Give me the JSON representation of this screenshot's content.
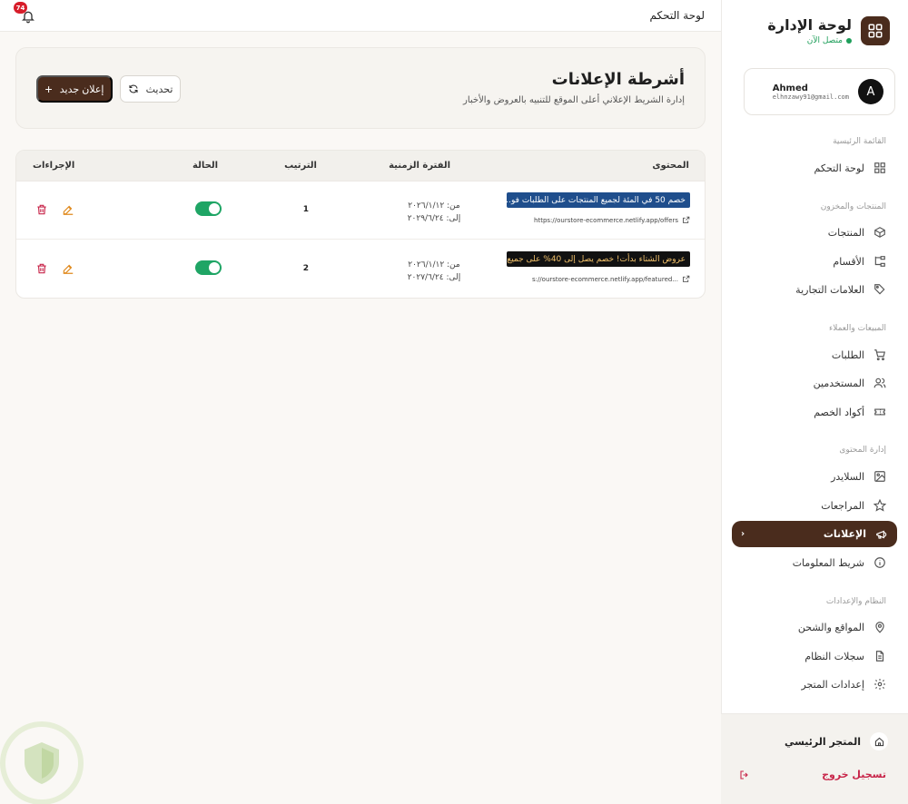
{
  "brand": {
    "title": "لوحة الإدارة",
    "status": "متصل الآن"
  },
  "user": {
    "initial": "A",
    "name": "Ahmed",
    "email": "elhnzawy91@gmail.com"
  },
  "nav": {
    "sections": [
      "القائمة الرئيسية",
      "المنتجات والمخزون",
      "المبيعات والعملاء",
      "إدارة المحتوى",
      "النظام والإعدادات"
    ],
    "items": [
      {
        "label": "لوحة التحكم",
        "icon": "grid-icon"
      },
      {
        "label": "المنتجات",
        "icon": "box-icon"
      },
      {
        "label": "الأقسام",
        "icon": "categories-icon"
      },
      {
        "label": "العلامات التجارية",
        "icon": "tag-icon"
      },
      {
        "label": "الطلبات",
        "icon": "cart-icon"
      },
      {
        "label": "المستخدمين",
        "icon": "users-icon"
      },
      {
        "label": "أكواد الخصم",
        "icon": "ticket-icon"
      },
      {
        "label": "السلايدر",
        "icon": "image-icon"
      },
      {
        "label": "المراجعات",
        "icon": "star-icon"
      },
      {
        "label": "الإعلانات",
        "icon": "megaphone-icon"
      },
      {
        "label": "شريط المعلومات",
        "icon": "info-icon"
      },
      {
        "label": "المواقع والشحن",
        "icon": "map-pin-icon"
      },
      {
        "label": "سجلات النظام",
        "icon": "file-icon"
      },
      {
        "label": "إعدادات المتجر",
        "icon": "gear-icon"
      }
    ],
    "active_index": 9
  },
  "footer": {
    "home": "المتجر الرئيسي",
    "logout": "تسجيل خروج"
  },
  "topbar": {
    "title": "لوحة التحكم",
    "notifications": "74"
  },
  "page": {
    "title": "أشرطة الإعلانات",
    "subtitle": "إدارة الشريط الإعلاني أعلى الموقع للتنبيه بالعروض والأخبار",
    "refresh_label": "تحديث",
    "new_label": "إعلان جديد"
  },
  "table": {
    "headers": {
      "content": "المحتوى",
      "period": "الفترة الزمنية",
      "order": "الترتيب",
      "status": "الحالة",
      "actions": "الإجراءات"
    },
    "rows": [
      {
        "text": "خصم 50 في المئة لجميع المنتجات على الطلبات فو...",
        "bg": "#1f4e8c",
        "fg": "#ffffff",
        "link": "https://ourstore-ecommerce.netlify.app/offers",
        "from": "من: ٢٠٢٦/١/١٢",
        "to": "إلى: ٢٠٢٩/٦/٢٤",
        "order": "1",
        "active": true
      },
      {
        "text": "عروض الشتاء بدأت! خصم يصل إلى 40% على جميع ا...",
        "bg": "#111111",
        "fg": "#f3c26b",
        "link": "s://ourstore-ecommerce.netlify.app/featured...",
        "from": "من: ٢٠٢٦/١/١٢",
        "to": "إلى: ٢٠٢٧/٦/٢٤",
        "order": "2",
        "active": true
      }
    ]
  },
  "colors": {
    "accent": "#4a2c1d",
    "success": "#1fa565",
    "danger": "#c8264a",
    "edit": "#e08a1e"
  }
}
